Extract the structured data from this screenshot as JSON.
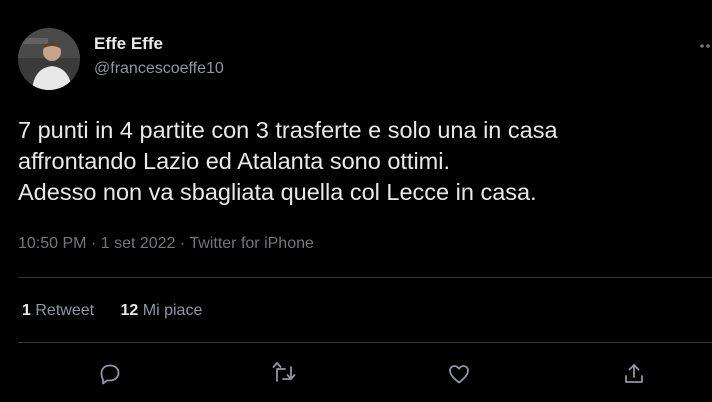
{
  "tweet": {
    "display_name": "Effe Effe",
    "handle": "@francescoeffe10",
    "text_lines": [
      "7 punti in 4 partite con 3 trasferte e solo una in casa",
      "affrontando Lazio ed Atalanta sono ottimi.",
      "Adesso non va sbagliata quella col Lecce in casa."
    ],
    "time": "10:50 PM",
    "date": "1 set 2022",
    "source": "Twitter for iPhone",
    "separator": "·"
  },
  "stats": {
    "retweets_count": "1",
    "retweets_label": "Retweet",
    "likes_count": "12",
    "likes_label": "Mi piace"
  },
  "actions": {
    "icons": [
      "reply-icon",
      "retweet-icon",
      "like-icon",
      "share-icon"
    ]
  },
  "colors": {
    "background": "#000000",
    "text": "#e7e9ea",
    "secondary": "#71767b",
    "divider": "#2f3336"
  }
}
